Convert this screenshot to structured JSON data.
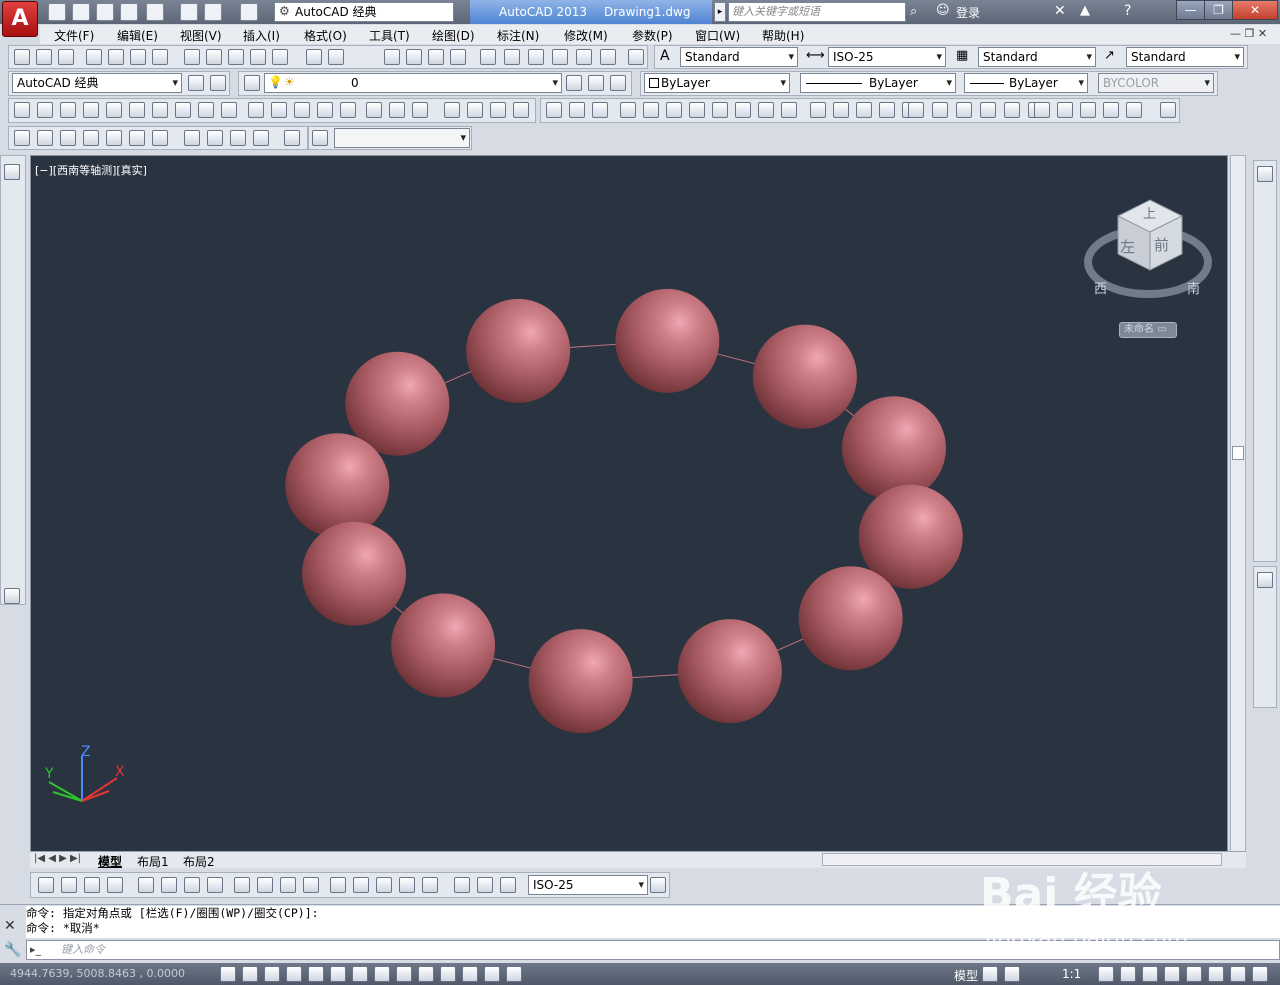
{
  "window": {
    "app_name": "AutoCAD 2013",
    "file_name": "Drawing1.dwg",
    "logo_letter": "A",
    "workspace": "AutoCAD 经典",
    "search_placeholder": "键入关键字或短语",
    "login": "登录",
    "min": "—",
    "max": "❐",
    "close": "✕"
  },
  "menu": [
    "文件(F)",
    "编辑(E)",
    "视图(V)",
    "插入(I)",
    "格式(O)",
    "工具(T)",
    "绘图(D)",
    "标注(N)",
    "修改(M)",
    "参数(P)",
    "窗口(W)",
    "帮助(H)"
  ],
  "styles": {
    "text_style": "Standard",
    "dim_style": "ISO-25",
    "table_style": "Standard",
    "mleader_style": "Standard"
  },
  "layers": {
    "workspace": "AutoCAD 经典",
    "current_layer": "0",
    "color": "ByLayer",
    "linetype": "ByLayer",
    "lineweight": "ByLayer",
    "plot_style": "BYCOLOR"
  },
  "viewport": {
    "label": "[−][西南等轴测][真实]",
    "viewcube_top": "上",
    "viewcube_left": "左",
    "viewcube_front": "前",
    "compass_w": "西",
    "compass_s": "南",
    "unnamed": "未命名 ▭",
    "ucs_x": "X",
    "ucs_y": "Y",
    "ucs_z": "Z",
    "bead_color": "#c0737a"
  },
  "layout_tabs": [
    "模型",
    "布局1",
    "布局2"
  ],
  "dim_toolbar": {
    "dim_style": "ISO-25"
  },
  "command": {
    "line1": "命令: 指定对角点或 [栏选(F)/圈围(WP)/圈交(CP)]:",
    "line2": "命令: *取消*",
    "input_placeholder": "键入命令"
  },
  "status": {
    "coords": "4944.7639, 5008.8463 , 0.0000",
    "model": "模型",
    "scale": "1:1"
  },
  "watermark": {
    "main": "Bai 经验",
    "sub": "jingyan.baidu.com"
  }
}
